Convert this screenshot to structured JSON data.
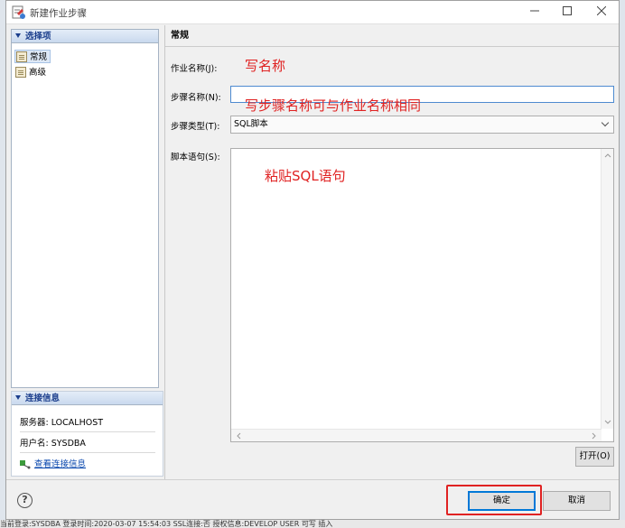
{
  "window": {
    "title": "新建作业步骤"
  },
  "left_panel": {
    "header": "选择项",
    "items": [
      {
        "label": "常规",
        "selected": true
      },
      {
        "label": "高级",
        "selected": false
      }
    ]
  },
  "connection": {
    "header": "连接信息",
    "server_line": "服务器: LOCALHOST",
    "user_line": "用户名: SYSDBA",
    "view_link": "查看连接信息"
  },
  "form": {
    "section_title": "常规",
    "job_name_label": "作业名称(J):",
    "step_name_label": "步骤名称(N):",
    "step_type_label": "步骤类型(T):",
    "step_type_value": "SQL脚本",
    "script_label": "脚本语句(S):",
    "open_button": "打开(O)"
  },
  "annotations": {
    "job_name": "写名称",
    "step_name": "写步骤名称可与作业名称相同",
    "script": "粘贴SQL语句"
  },
  "buttons": {
    "ok": "确定",
    "cancel": "取消",
    "help": "?"
  },
  "status_bar": {
    "text": "当前登录:SYSDBA    登录时间:2020-03-07 15:54:03    SSL连接:否    授权信息:DEVELOP USER                    可写         插入"
  },
  "colors": {
    "accent": "#0078d7",
    "annotation": "#e02222",
    "link": "#0645ad"
  }
}
